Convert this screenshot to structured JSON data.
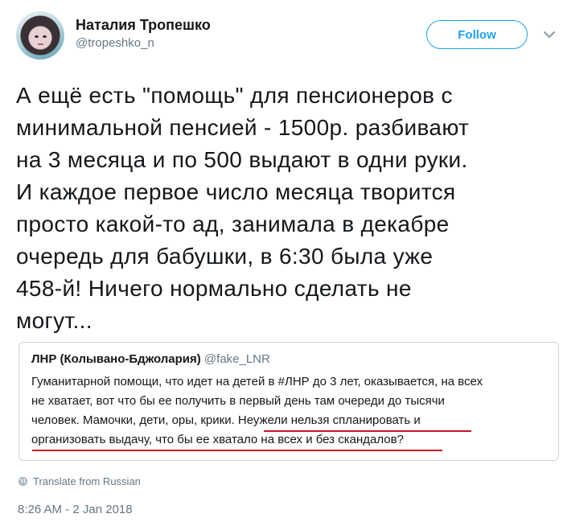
{
  "tweet": {
    "author_name": "Наталия Тропешко",
    "author_handle": "@tropeshko_n",
    "follow_label": "Follow",
    "text": "А ещё есть \"помощь\" для пенсионеров с\nминимальной пенсией - 1500р. разбивают\nна 3 месяца и по 500 выдают в одни руки.\nИ каждое первое число месяца творится\nпросто какой-то ад, занимала в декабре\nочередь для бабушки, в 6:30 была уже\n458-й! Ничего нормально сделать не\nмогут...",
    "translate_label": "Translate from Russian",
    "timestamp": "8:26 AM - 2 Jan 2018"
  },
  "quoted": {
    "author_name": "ЛНР (Колывано-Бджолария)",
    "author_handle": "@fake_LNR",
    "text": "Гуманитарной помощи, что идет на детей в #ЛНР до 3 лет, оказывается, на всех\nне хватает, вот что бы ее получить в первый день там очереди до тысячи\nчеловек. Мамочки, дети, оры, крики. Неужели нельзя спланировать и\nорганизовать выдачу, что бы ее хватало на всех и без скандалов?"
  },
  "icons": {
    "avatar": "avatar-photo",
    "dropdown": "chevron-down-icon",
    "translate": "globe-icon"
  },
  "colors": {
    "accent": "#1da1f2",
    "muted": "#657786",
    "annotation": "#d0112b"
  }
}
